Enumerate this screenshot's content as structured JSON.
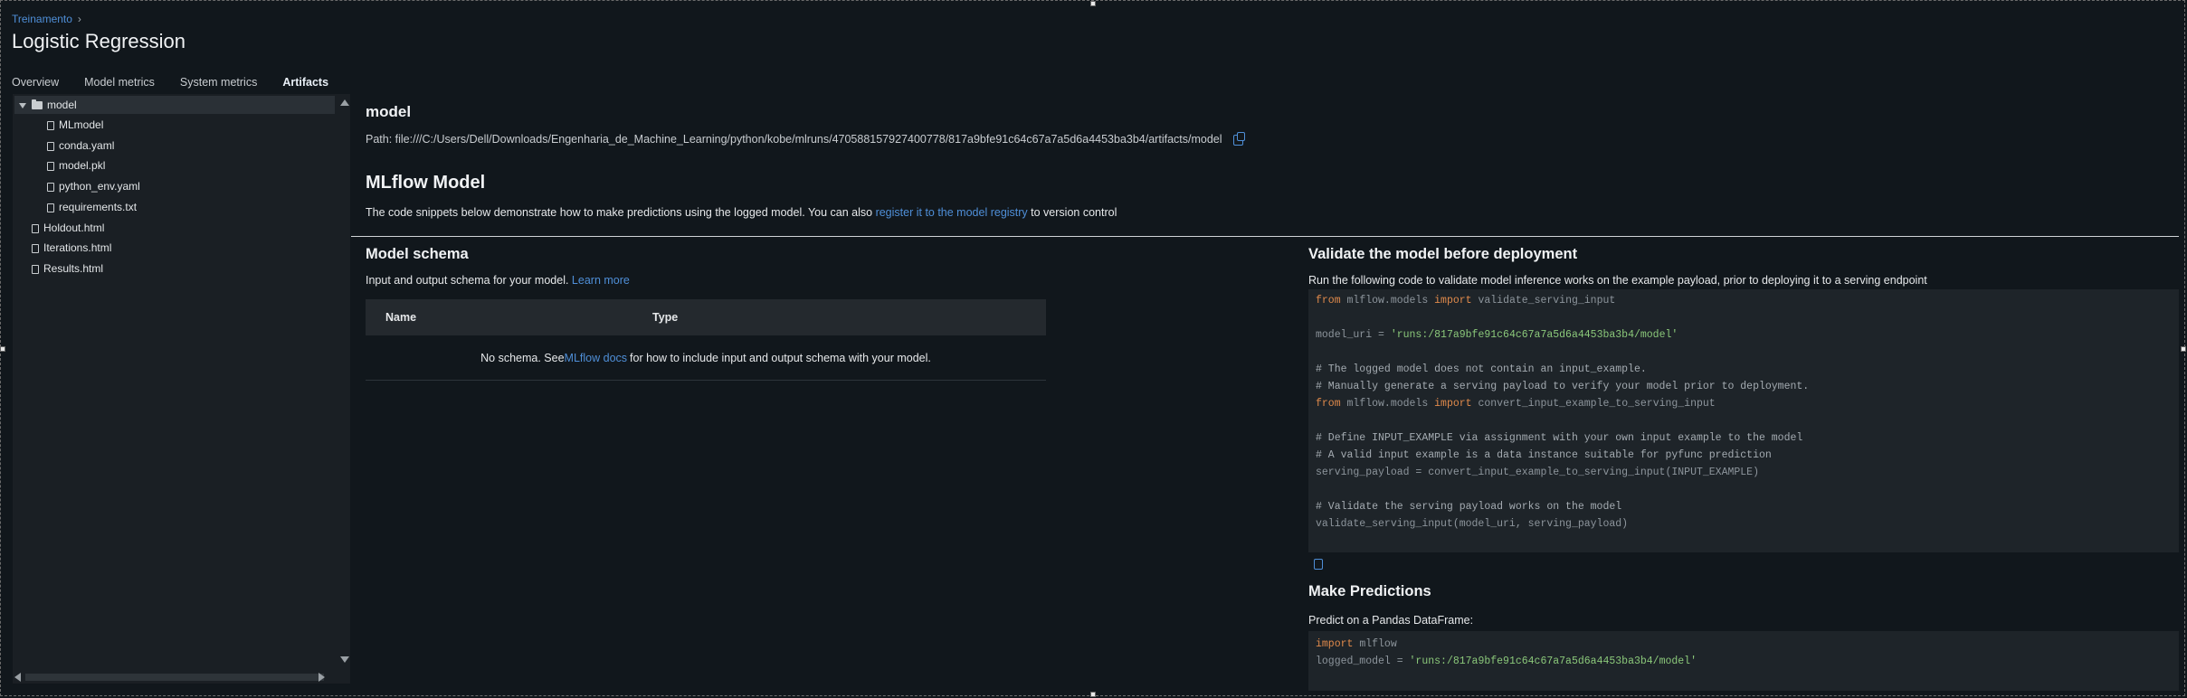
{
  "breadcrumb": {
    "parent": "Treinamento",
    "separator": "›"
  },
  "title": "Logistic Regression",
  "tabs": [
    {
      "label": "Overview",
      "active": false
    },
    {
      "label": "Model metrics",
      "active": false
    },
    {
      "label": "System metrics",
      "active": false
    },
    {
      "label": "Artifacts",
      "active": true
    }
  ],
  "tree": {
    "items": [
      {
        "label": "model",
        "type": "folder",
        "expanded": true,
        "selected": true
      },
      {
        "label": "MLmodel",
        "type": "file"
      },
      {
        "label": "conda.yaml",
        "type": "file"
      },
      {
        "label": "model.pkl",
        "type": "file"
      },
      {
        "label": "python_env.yaml",
        "type": "file"
      },
      {
        "label": "requirements.txt",
        "type": "file"
      },
      {
        "label": "Holdout.html",
        "type": "file"
      },
      {
        "label": "Iterations.html",
        "type": "file"
      },
      {
        "label": "Results.html",
        "type": "file"
      }
    ]
  },
  "artifact": {
    "name": "model",
    "path": "Path: file:///C:/Users/Dell/Downloads/Engenharia_de_Machine_Learning/python/kobe/mlruns/470588157927400778/817a9bfe91c64c67a7a5d6a4453ba3b4/artifacts/model"
  },
  "mlflow_model": {
    "heading": "MLflow Model",
    "desc_before": "The code snippets below demonstrate how to make predictions using the logged model. You can also ",
    "desc_link": "register it to the model registry",
    "desc_after": " to version control"
  },
  "schema": {
    "heading": "Model schema",
    "desc": "Input and output schema for your model. ",
    "learn_more": "Learn more",
    "columns": [
      "Name",
      "Type"
    ],
    "empty_before": "No schema. See ",
    "empty_link": "MLflow docs",
    "empty_after": " for how to include input and output schema with your model."
  },
  "validate": {
    "heading": "Validate the model before deployment",
    "desc": "Run the following code to validate model inference works on the example payload, prior to deploying it to a serving endpoint",
    "code": [
      {
        "kind": "import",
        "kw1": "from",
        "mod": " mlflow.models ",
        "kw2": "import",
        "rest": " validate_serving_input"
      },
      {
        "kind": "blank"
      },
      {
        "kind": "assign",
        "lhs": "model_uri = ",
        "str": "'runs:/817a9bfe91c64c67a7a5d6a4453ba3b4/model'"
      },
      {
        "kind": "blank"
      },
      {
        "kind": "comment",
        "text": "# The logged model does not contain an input_example."
      },
      {
        "kind": "comment",
        "text": "# Manually generate a serving payload to verify your model prior to deployment."
      },
      {
        "kind": "import",
        "kw1": "from",
        "mod": " mlflow.models ",
        "kw2": "import",
        "rest": " convert_input_example_to_serving_input"
      },
      {
        "kind": "blank"
      },
      {
        "kind": "comment",
        "text": "# Define INPUT_EXAMPLE via assignment with your own input example to the model"
      },
      {
        "kind": "comment",
        "text": "# A valid input example is a data instance suitable for pyfunc prediction"
      },
      {
        "kind": "plain",
        "text": "serving_payload = convert_input_example_to_serving_input(INPUT_EXAMPLE)"
      },
      {
        "kind": "blank"
      },
      {
        "kind": "comment",
        "text": "# Validate the serving payload works on the model"
      },
      {
        "kind": "plain",
        "text": "validate_serving_input(model_uri, serving_payload)"
      }
    ]
  },
  "predict": {
    "heading": "Make Predictions",
    "desc": "Predict on a Pandas DataFrame:",
    "code": [
      {
        "kind": "import2",
        "kw1": "import",
        "rest": " mlflow"
      },
      {
        "kind": "assign",
        "lhs": "logged_model = ",
        "str": "'runs:/817a9bfe91c64c67a7a5d6a4453ba3b4/model'"
      }
    ]
  }
}
